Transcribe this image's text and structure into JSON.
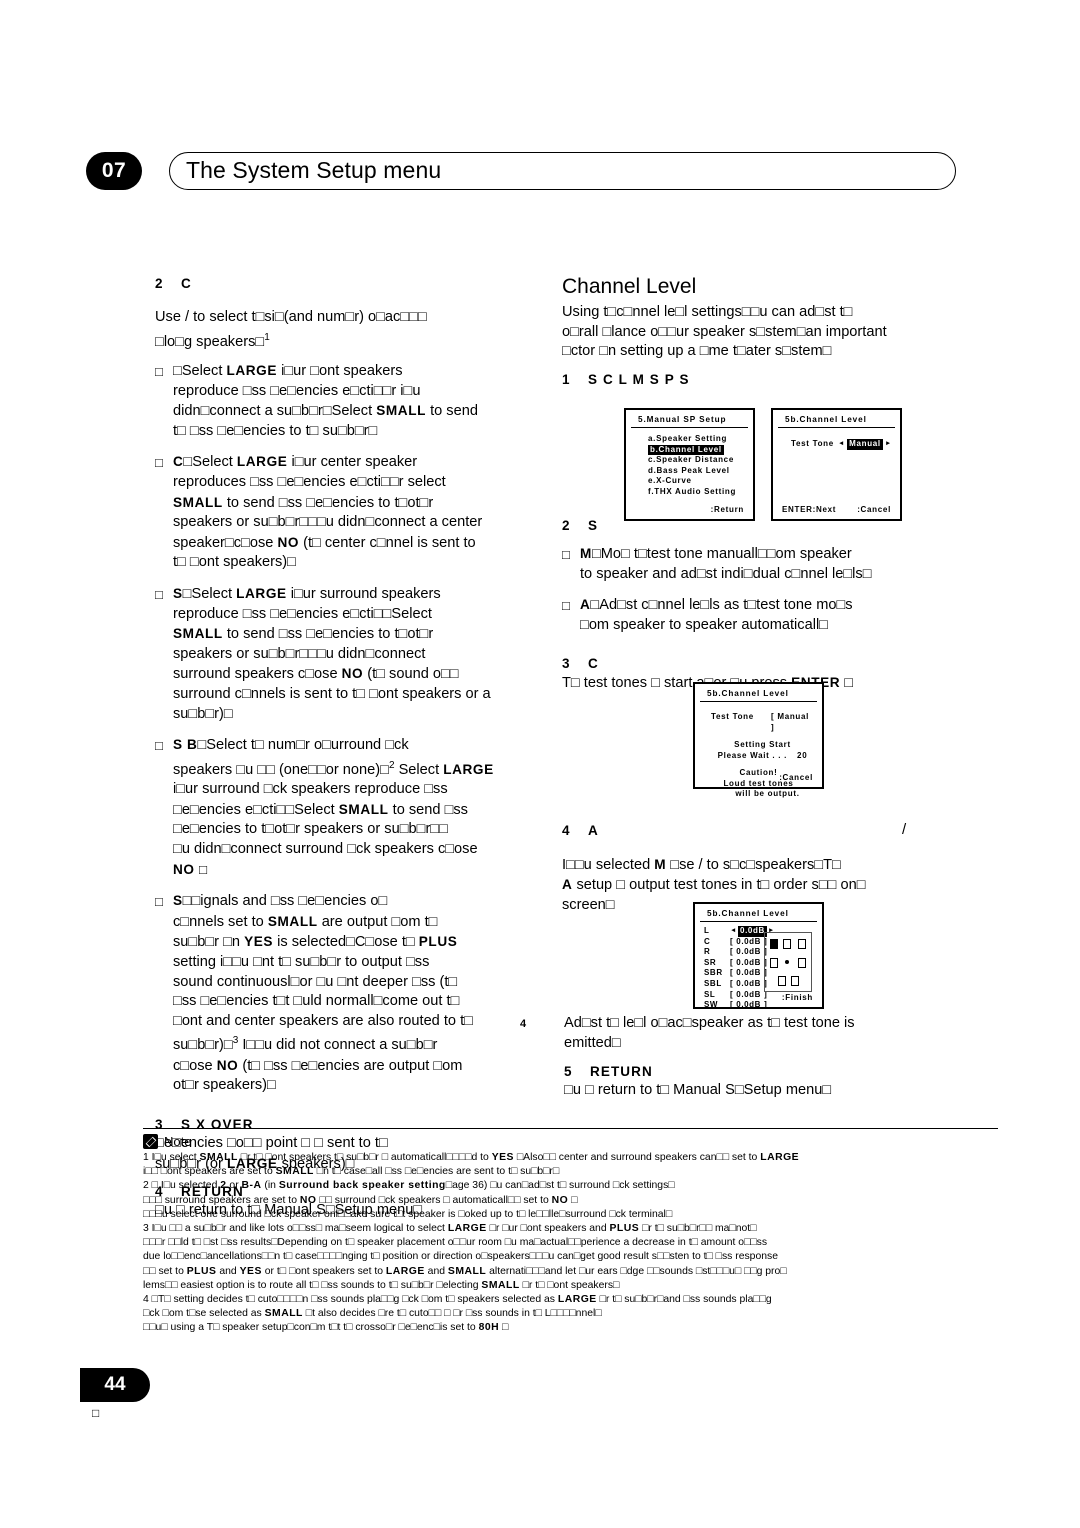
{
  "header": {
    "chapter_number": "07",
    "title": "The System Setup menu"
  },
  "page_number": "44",
  "page_number_sub": "□",
  "left_column": {
    "step2": {
      "num": "2",
      "label": "C",
      "intro_line1": "Use  /      to select t□si□(and num□r) o□ac□□□",
      "intro_line2": "□lo□g speakers□",
      "intro_sup": "1",
      "bullets": [
        {
          "term": "",
          "text_parts": [
            "– ",
            "□Select ",
            "LARGE",
            "   i□ur □ont speakers reproduce □ss □e□encies e□cti□□r i□u didn□connect a su□b□r□Select ",
            "SMALL",
            "   to send t□ □ss □e□encies to t□ su□b□r□"
          ],
          "label": "",
          "line1_a": "□Select ",
          "line1_b": "LARGE",
          "line1_c": "   i□ur □ont speakers",
          "line2": "reproduce □ss □e□encies e□cti□□r i□u",
          "line3_a": "didn□connect a su□b□r□Select ",
          "line3_b": "SMALL",
          "line3_c": "   to send",
          "line4": "t□ □ss □e□encies to t□ su□b□r□"
        }
      ]
    },
    "bullet_center": {
      "label": "C",
      "line1_a": "□Select ",
      "line1_b": "LARGE",
      "line1_c": "   i□ur center speaker",
      "line2": "reproduces □ss □e□encies e□cti□□r select",
      "line3_a": "SMALL",
      "line3_b": "   to send □ss □e□encies to t□ot□r",
      "line4": "speakers or su□b□r□□□u didn□connect a center",
      "line5_a": "speaker□c□ose  ",
      "line5_b": "NO",
      "line5_c": "   (t□ center c□nnel is sent to",
      "line6": "t□ □ont speakers)□"
    },
    "bullet_surround": {
      "label": "S",
      "line1_a": "□Select ",
      "line1_b": "LARGE",
      "line1_c": "   i□ur surround speakers",
      "line2": "reproduce □ss □e□encies e□cti□□Select",
      "line3_a": "SMALL",
      "line3_b": "   to send □ss □e□encies to t□ot□r",
      "line4": "speakers or su□b□r□□□u didn□connect",
      "line5_a": "surround speakers c□ose  ",
      "line5_b": "NO",
      "line5_c": "   (t□ sound o□□",
      "line6": "surround c□nnels is sent to t□ □ont speakers or a",
      "line7": "su□b□r)□"
    },
    "bullet_surround_back": {
      "label": "S B",
      "line1": "□Select t□ num□r o□urround □ck",
      "line2_a": "speakers □u □□ (one□□or none)□",
      "line2_sup": "2",
      "line2_b": " Select ",
      "line2_c": "LARGE",
      "line3": "i□ur surround □ck speakers reproduce □ss",
      "line4_a": "□e□encies e□cti□□Select  ",
      "line4_b": "SMALL",
      "line4_c": "    to send □ss",
      "line5": "□e□encies to t□ot□r speakers or su□b□r□□",
      "line6": "□u didn□connect surround □ck speakers c□ose",
      "line7": "NO □"
    },
    "bullet_subwoofer": {
      "label": "S",
      "line1": "□□ignals and □ss □e□encies o□",
      "line2_a": "c□nnels set to  ",
      "line2_b": "SMALL",
      "line2_c": "   are output □om t□",
      "line3_a": "su□b□r □n         ",
      "line3_b": "YES",
      "line3_c": "  is selected□C□ose t□    ",
      "line3_d": "PLUS",
      "line4": "setting i□□u □nt t□ su□b□r to output □ss",
      "line5": "sound continuousl□or □u □nt deeper □ss (t□",
      "line6": "□ss □e□encies t□t □uld normall□come out t□",
      "line7": "□ont and center speakers are also routed to t□",
      "line8_a": "su□b□r)□",
      "line8_sup": "3",
      "line8_b": " I□□u did not connect a su□b□r",
      "line9_a": "c□ose  ",
      "line9_b": "NO",
      "line9_c": "   (t□ □ss □e□encies are output □om",
      "line10": "ot□r speakers)□"
    },
    "step3": {
      "num": "3",
      "label": "S X OVER",
      "line1": "□e□encies □o□□ point □ □ sent to t□",
      "line2_a": "su□b□r (or   ",
      "line2_b": "LARGE",
      "line2_c": "   speakers)□"
    },
    "step4": {
      "num": "4",
      "label": "RETURN",
      "line1": "□u □ return to t□ Manual S□Setup menu□"
    }
  },
  "right_column": {
    "section_title": "Channel Level",
    "intro_line1": "Using t□c□nnel le□l settings□□u can ad□st t□",
    "intro_line2": "o□rall □lance o□□ur speaker s□stem□an important",
    "intro_line3": "□ctor □n setting up a □me t□ater s□stem□",
    "step1": {
      "num": "1",
      "label": "S C L   M S P S"
    },
    "step2": {
      "num": "2",
      "label": "S",
      "bullet1": {
        "label": "M",
        "line1": "□Mo□ t□test tone manuall□□om speaker",
        "line2": "to speaker and ad□st indi□dual c□nnel le□ls□"
      },
      "bullet2": {
        "label": "A",
        "line1": "□Ad□st c□nnel le□ls as t□test tone mo□s",
        "line2": "□om speaker to speaker automaticall□"
      }
    },
    "step3": {
      "num": "3",
      "label": "C",
      "line_a": "T□ test tones □ start a□er □u press    ",
      "line_b": "ENTER",
      "line_c": " □"
    },
    "step4": {
      "num": "4",
      "label": "A",
      "slash": "/",
      "line1_a": "I□□u selected  ",
      "line1_b": "M",
      "line1_c": "        □se  /      to s□c□speakers□T□",
      "line2_a": "A",
      "line2_b": "       setup □ output test tones in t□ order s□□ on□",
      "line3": "screen□"
    },
    "step_adjust": {
      "num": "4",
      "line1": "Ad□st t□ le□l o□ac□speaker as t□ test tone is",
      "line2": "emitted□"
    },
    "step5": {
      "num": "5",
      "label": "RETURN",
      "line1": "□u □ return to t□ Manual S□Setup menu□"
    }
  },
  "osd": {
    "manual_sp_setup": {
      "title": "5.Manual  SP  Setup",
      "items": [
        "a.Speaker  Setting",
        "b.Channel  Level",
        "c.Speaker  Distance",
        "d.Bass  Peak  Level",
        "e.X-Curve",
        "f.THX  Audio  Setting"
      ],
      "selected_index": 1,
      "footer_right": ":Return"
    },
    "channel_level_testtone": {
      "title": "5b.Channel  Level",
      "row_label": "Test  Tone",
      "arrow_left": "◄",
      "value": "Manual",
      "arrow_right": "►",
      "footer_left": "ENTER:Next",
      "footer_right": ":Cancel"
    },
    "channel_level_wait": {
      "title": "5b.Channel  Level",
      "row_label": "Test  Tone",
      "row_value": "[ Manual ]",
      "line1": "Setting  Start",
      "line2": "Please  Wait . . .",
      "counter": "20",
      "caution": "Caution!",
      "caution_line1": "Loud  test  tones",
      "caution_line2": "will  be  output.",
      "footer_right": ":Cancel"
    },
    "channel_level_levels": {
      "title": "5b.Channel  Level",
      "channels": [
        {
          "name": "L",
          "value": "0.0dB",
          "selected": true
        },
        {
          "name": "C",
          "value": "0.0dB",
          "selected": false
        },
        {
          "name": "R",
          "value": "0.0dB",
          "selected": false
        },
        {
          "name": "SR",
          "value": "0.0dB",
          "selected": false
        },
        {
          "name": "SBR",
          "value": "0.0dB",
          "selected": false
        },
        {
          "name": "SBL",
          "value": "0.0dB",
          "selected": false
        },
        {
          "name": "SL",
          "value": "0.0dB",
          "selected": false
        },
        {
          "name": "SW",
          "value": "0.0dB",
          "selected": false
        }
      ],
      "arrow_left": "◄",
      "arrow_right": "►",
      "bracket_open": "[",
      "bracket_close": "]",
      "footer_right": ":Finish"
    }
  },
  "notes": {
    "header_label": "Note",
    "lines": [
      {
        "parts": [
          {
            "t": "1 I□u select  ",
            "b": false
          },
          {
            "t": "SMALL",
            "b": true
          },
          {
            "t": "   □r t□ □ont speakers t□ su□b□r □ automaticall□□□□d to                      ",
            "b": false
          },
          {
            "t": "YES",
            "b": true
          },
          {
            "t": "  □Also□□ center and surround speakers can□□ set to       ",
            "b": false
          },
          {
            "t": "LARGE",
            "b": true
          }
        ]
      },
      {
        "parts": [
          {
            "t": "i□□ □ont speakers are set to    ",
            "b": false
          },
          {
            "t": "SMALL",
            "b": true
          },
          {
            "t": "    □n t□ case□all □ss □e□encies are sent to t□ su□b□r□",
            "b": false
          }
        ]
      },
      {
        "parts": [
          {
            "t": "2 □ I□u selected  ",
            "b": false
          },
          {
            "t": "2",
            "b": true
          },
          {
            "t": "           or ",
            "b": false
          },
          {
            "t": "B-A",
            "b": true
          },
          {
            "t": "                    (in ",
            "b": false
          },
          {
            "t": "Surround back speaker setting",
            "b": true
          },
          {
            "t": "□age 36) □u can□ad□st t□ surround □ck settings□",
            "b": false
          }
        ]
      },
      {
        "parts": [
          {
            "t": "    □□□ surround speakers are set to    ",
            "b": false
          },
          {
            "t": "NO",
            "b": true
          },
          {
            "t": "  □□ surround □ck speakers □ automaticall□□ set to       ",
            "b": false
          },
          {
            "t": "NO",
            "b": true
          },
          {
            "t": " □",
            "b": false
          }
        ]
      },
      {
        "parts": [
          {
            "t": "    □□□u select one surround □ck speaker onl□□ake sure t□t speaker is □oked up to t□ le□□lle□surround □ck terminal□",
            "b": false
          }
        ]
      },
      {
        "parts": [
          {
            "t": "3 I□u □□ a su□b□r and like lots o□□ss□ ma□seem logical to select          ",
            "b": false
          },
          {
            "t": "LARGE",
            "b": true
          },
          {
            "t": "    □r □ur □ont speakers and   ",
            "b": false
          },
          {
            "t": "PLUS",
            "b": true
          },
          {
            "t": "   □r t□ su□b□r□□ ma□not□",
            "b": false
          }
        ]
      },
      {
        "parts": [
          {
            "t": "□□□r □□ld t□ □st □ss results□Depending on t□ speaker placement o□□ur room □u ma□actual□□perience a decrease in                      t□ amount o□□ss",
            "b": false
          }
        ]
      },
      {
        "parts": [
          {
            "t": "due lo□□enc□ancellations□□n t□ case□□□□nging t□ position or direction o□speakers□□□u can□get good result            s□□sten to t□ □ss response",
            "b": false
          }
        ]
      },
      {
        "parts": [
          {
            "t": "□□ set to    ",
            "b": false
          },
          {
            "t": "PLUS",
            "b": true
          },
          {
            "t": "  and ",
            "b": false
          },
          {
            "t": "YES",
            "b": true
          },
          {
            "t": "  or t□ □ont speakers set to  ",
            "b": false
          },
          {
            "t": "LARGE",
            "b": true
          },
          {
            "t": "   and ",
            "b": false
          },
          {
            "t": "SMALL",
            "b": true
          },
          {
            "t": "   alternati□□□and let □ur ears □dge □□sounds □st□□□u□ □□g pro□",
            "b": false
          }
        ]
      },
      {
        "parts": [
          {
            "t": "lems□□ easiest option is to route all t□ □ss sounds to t□ su□b□r □electing                      ",
            "b": false
          },
          {
            "t": "SMALL",
            "b": true
          },
          {
            "t": "   □r t□ □ont speakers□",
            "b": false
          }
        ]
      },
      {
        "parts": [
          {
            "t": "4 □T□ setting decides t□ cuto□□□□n □ss sounds pla□□g □ck □om t□ speakers selected as          ",
            "b": false
          },
          {
            "t": "LARGE",
            "b": true
          },
          {
            "t": "   □r t□ su□b□r□and □ss sounds pla□□g",
            "b": false
          }
        ]
      },
      {
        "parts": [
          {
            "t": "□ck □om t□se selected as    ",
            "b": false
          },
          {
            "t": "SMALL",
            "b": true
          },
          {
            "t": "   □t also decides □re t□ cuto□□ □ □r □ss sounds in t□ L□□□□nnel□",
            "b": false
          }
        ]
      },
      {
        "parts": [
          {
            "t": "    □□u□ using a T□ speaker setup□con□m t□t t□ crosso□r □e□enc□is set to               ",
            "b": false
          },
          {
            "t": "80H",
            "b": true
          },
          {
            "t": "  □",
            "b": false
          }
        ]
      }
    ]
  }
}
